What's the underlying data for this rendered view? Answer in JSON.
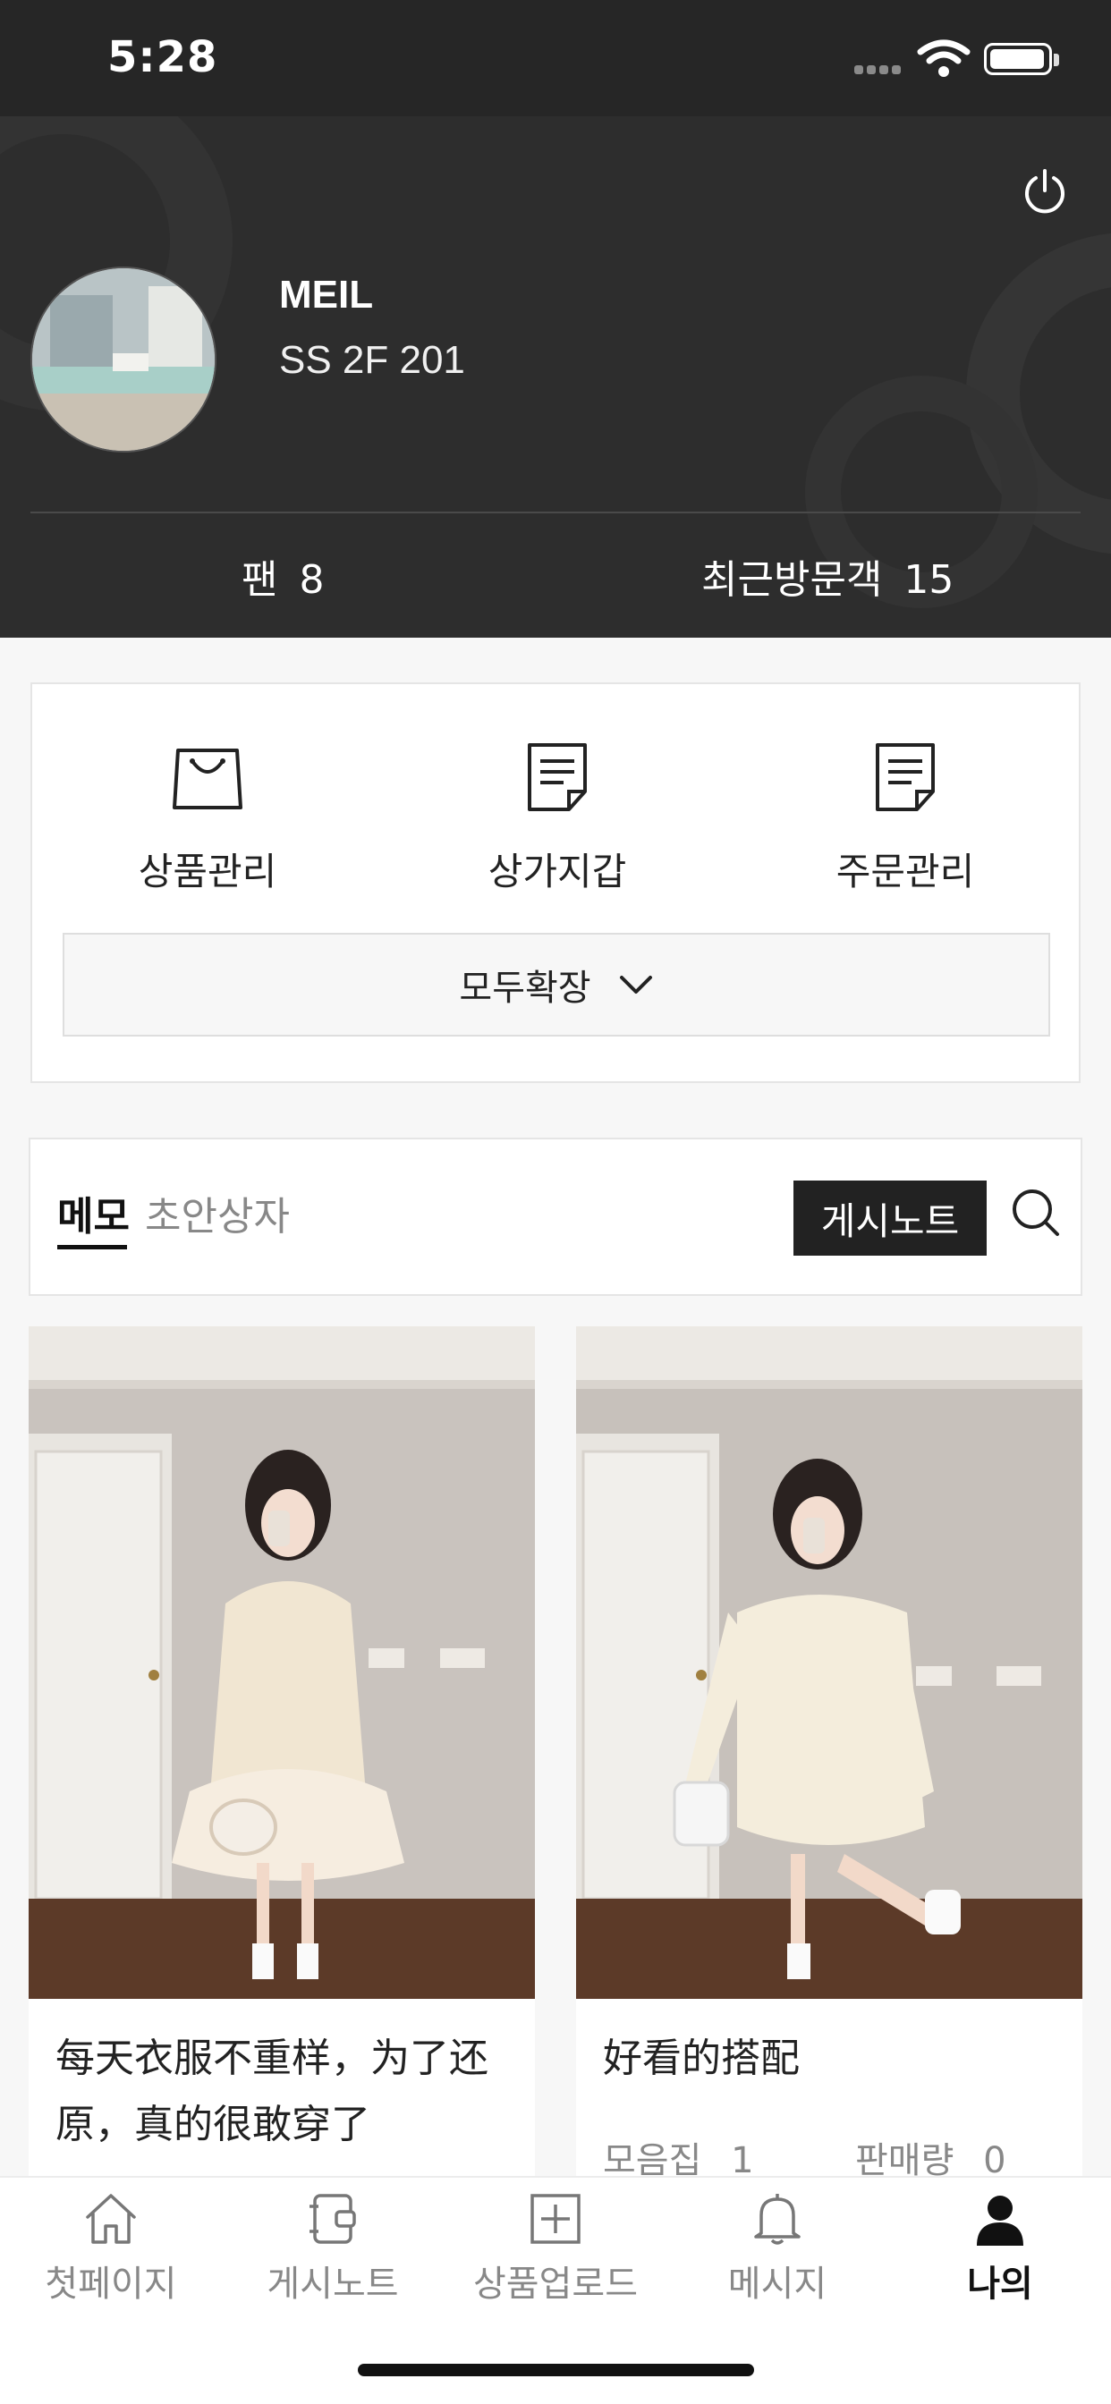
{
  "status_bar": {
    "time": "5:28"
  },
  "profile": {
    "name": "MEIL",
    "address": "SS 2F 201",
    "fans_label": "팬",
    "fans_count": "8",
    "visitors_label": "최근방문객",
    "visitors_count": "15"
  },
  "menu": {
    "items": [
      {
        "label": "상품관리",
        "icon": "shopping-bag-icon"
      },
      {
        "label": "상가지갑",
        "icon": "document-icon"
      },
      {
        "label": "주문관리",
        "icon": "document-icon"
      }
    ],
    "expand_label": "모두확장"
  },
  "tabs": {
    "memo": "메모",
    "draft": "초안상자",
    "post_button": "게시노트"
  },
  "posts": [
    {
      "title_line1": "每天衣服不重样，为了还",
      "title_line2": "原，真的很敢穿了"
    },
    {
      "title": "好看的搭配",
      "collection_label": "모음집",
      "collection_count": "1",
      "sales_label": "판매량",
      "sales_count": "0"
    }
  ],
  "bottom_nav": {
    "items": [
      {
        "label": "첫페이지",
        "icon": "home-icon"
      },
      {
        "label": "게시노트",
        "icon": "notebook-icon"
      },
      {
        "label": "상품업로드",
        "icon": "plus-square-icon"
      },
      {
        "label": "메시지",
        "icon": "bell-icon"
      },
      {
        "label": "나의",
        "icon": "person-icon",
        "active": true
      }
    ]
  }
}
